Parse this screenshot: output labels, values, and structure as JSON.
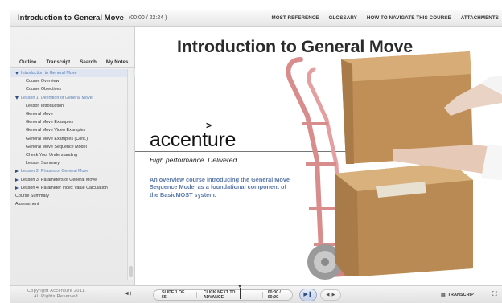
{
  "header": {
    "title": "Introduction to General Move",
    "time": "(00:00 / 22:24 )",
    "nav": [
      "MOST REFERENCE",
      "GLOSSARY",
      "HOW TO NAVIGATE THIS COURSE",
      "ATTACHMENTS"
    ]
  },
  "sidebar": {
    "tabs": [
      "Outline",
      "Transcript",
      "Search",
      "My Notes"
    ],
    "items": [
      {
        "label": "Introduction to General Move",
        "level": 0,
        "arrow": "down",
        "blue": true,
        "selected": true
      },
      {
        "label": "Course Overview",
        "level": 1
      },
      {
        "label": "Course Objectives",
        "level": 1
      },
      {
        "label": "Lesson 1:  Definition of General Move",
        "level": 0,
        "arrow": "down",
        "blue": true
      },
      {
        "label": "Lesson Introduction",
        "level": 1
      },
      {
        "label": "General Move",
        "level": 1
      },
      {
        "label": "General Move Examples",
        "level": 1
      },
      {
        "label": "General Move Video Examples",
        "level": 1
      },
      {
        "label": "General Move Examples (Cont.)",
        "level": 1
      },
      {
        "label": "General Move Sequence Model",
        "level": 1
      },
      {
        "label": "Check Your Understanding",
        "level": 1
      },
      {
        "label": "Lesson Summary",
        "level": 1
      },
      {
        "label": "Lesson 2:  Phases of General Move",
        "level": 0,
        "arrow": "right",
        "blue": true
      },
      {
        "label": "Lesson 3:  Parameters of General Move",
        "level": 0,
        "arrow": "right"
      },
      {
        "label": "Lesson 4:  Parameter Index Value Calculation",
        "level": 0,
        "arrow": "right"
      },
      {
        "label": "Course Summary",
        "level": 0
      },
      {
        "label": "Assessment",
        "level": 0
      }
    ]
  },
  "slide": {
    "title": "Introduction to General Move",
    "brand": "accenture",
    "brand_mark": ">",
    "tagline": "High performance. Delivered.",
    "description": "An overview course introducing the General Move Sequence Model as a foundational component of the BasicMOST system."
  },
  "footer": {
    "copyright_line1": "Copyright  Accenture  2011.",
    "copyright_line2": "All Rights Reserved.",
    "slide_counter": "SLIDE 1 OF 55",
    "advance_hint": "CLICK NEXT TO ADVANCE",
    "timer": "00:00 / 00:00",
    "transcript_label": "TRANSCRIPT"
  },
  "colors": {
    "accent_blue": "#5a78a8",
    "nav_dark": "#2f4f80",
    "box_brown": "#c79a63",
    "cart_red": "#d98c8c"
  }
}
